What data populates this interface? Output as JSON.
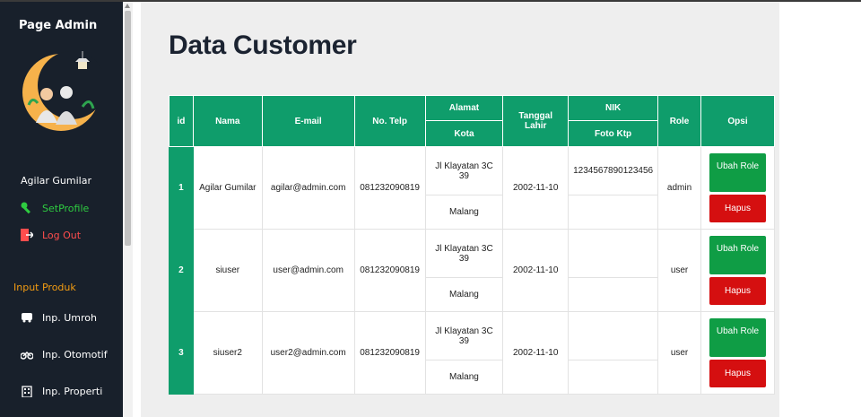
{
  "sidebar": {
    "brand": "Page Admin",
    "user_name": "Agilar Gumilar",
    "links": [
      {
        "label": "SetProfile",
        "icon": "wrench-icon",
        "color": "#2ecc40"
      },
      {
        "label": "Log Out",
        "icon": "logout-icon",
        "color": "#ff4d4d"
      }
    ],
    "section_title": "Input Produk",
    "menu": [
      {
        "label": "Inp. Umroh",
        "icon": "bus-icon"
      },
      {
        "label": "Inp. Otomotif",
        "icon": "motorcycle-icon"
      },
      {
        "label": "Inp. Properti",
        "icon": "building-icon"
      }
    ]
  },
  "main": {
    "title": "Data Customer"
  },
  "table": {
    "headers": {
      "id": "id",
      "nama": "Nama",
      "email": "E-mail",
      "telp": "No. Telp",
      "alamat": "Alamat",
      "kota": "Kota",
      "tanggal_lahir": "Tanggal Lahir",
      "nik": "NIK",
      "foto_ktp": "Foto Ktp",
      "role": "Role",
      "opsi": "Opsi"
    },
    "rows": [
      {
        "id": "1",
        "nama": "Agilar Gumilar",
        "email": "agilar@admin.com",
        "telp": "081232090819",
        "alamat": "Jl Klayatan 3C 39",
        "kota": "Malang",
        "tanggal_lahir": "2002-11-10",
        "nik": "1234567890123456",
        "foto_ktp": "",
        "role": "admin"
      },
      {
        "id": "2",
        "nama": "siuser",
        "email": "user@admin.com",
        "telp": "081232090819",
        "alamat": "Jl Klayatan 3C 39",
        "kota": "Malang",
        "tanggal_lahir": "2002-11-10",
        "nik": "",
        "foto_ktp": "",
        "role": "user"
      },
      {
        "id": "3",
        "nama": "siuser2",
        "email": "user2@admin.com",
        "telp": "081232090819",
        "alamat": "Jl Klayatan 3C 39",
        "kota": "Malang",
        "tanggal_lahir": "2002-11-10",
        "nik": "",
        "foto_ktp": "",
        "role": "user"
      }
    ],
    "buttons": {
      "edit": "Ubah Role",
      "delete": "Hapus"
    }
  },
  "colors": {
    "sidebar_bg": "#18202b",
    "table_header": "#0f9d6b",
    "edit_button": "#0f9d45",
    "delete_button": "#d50f10",
    "section_title": "#f39c12"
  }
}
